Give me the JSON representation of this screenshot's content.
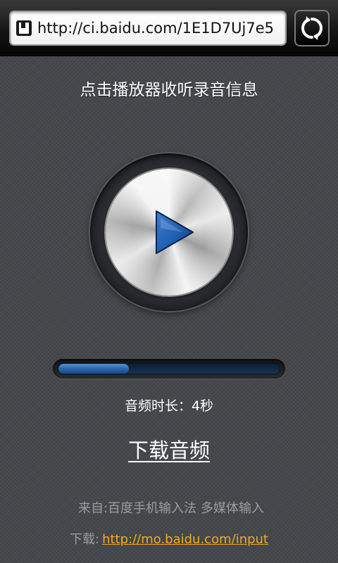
{
  "browser": {
    "url": "http://ci.baidu.com/1E1D7Uj7e5"
  },
  "player": {
    "prompt": "点击播放器收听录音信息",
    "progress_fraction": 0.32,
    "duration_label": "音频时长：",
    "duration_value": "4秒",
    "download_audio": "下载音频"
  },
  "footer": {
    "source_label": "来自:百度手机输入法",
    "source_tag": "多媒体输入",
    "download_label": "下载:",
    "download_url": "http://mo.baidu.com/input"
  },
  "colors": {
    "accent_link": "#f4a91e",
    "play_icon": "#1f5fb1",
    "progress_fill": "#2b66ad"
  },
  "icons": {
    "site": "page-icon",
    "refresh": "refresh-icon",
    "play": "play-icon"
  }
}
